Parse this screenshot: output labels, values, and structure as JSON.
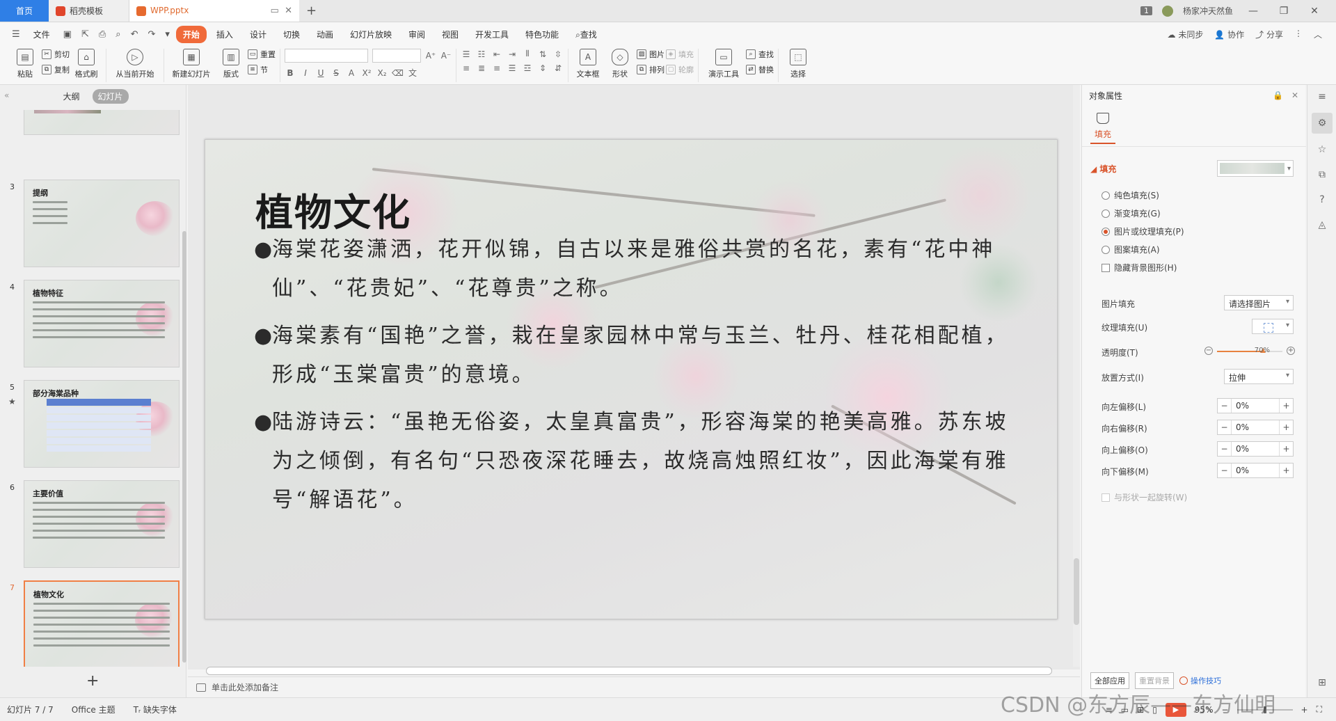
{
  "tabs": [
    {
      "label": "首页"
    },
    {
      "label": "稻壳模板"
    },
    {
      "label": "WPP.pptx"
    }
  ],
  "titlebar": {
    "badge": "1",
    "user": "杨家冲天然鱼"
  },
  "menu": {
    "file": "文件",
    "items": [
      "开始",
      "插入",
      "设计",
      "切换",
      "动画",
      "幻灯片放映",
      "审阅",
      "视图",
      "开发工具",
      "特色功能"
    ],
    "search": "查找",
    "right": [
      "未同步",
      "协作",
      "分享"
    ]
  },
  "ribbon": {
    "paste": "粘贴",
    "cut": "剪切",
    "copy": "复制",
    "format_painter": "格式刷",
    "from_current": "从当前开始",
    "new_slide": "新建幻灯片",
    "layout": "版式",
    "reset": "重置",
    "section": "节",
    "textbox": "文本框",
    "shape": "形状",
    "picture": "图片",
    "arrange": "排列",
    "fill": "填充",
    "outline": "轮廓",
    "present_tools": "演示工具",
    "find": "查找",
    "replace": "替换",
    "select": "选择"
  },
  "leftpane": {
    "tab_outline": "大纲",
    "tab_slides": "幻灯片",
    "slides": [
      {
        "num": "3",
        "title": "提纲",
        "kind": "text"
      },
      {
        "num": "4",
        "title": "植物特征",
        "kind": "text"
      },
      {
        "num": "5",
        "title": "部分海棠品种",
        "kind": "table"
      },
      {
        "num": "6",
        "title": "主要价值",
        "kind": "text"
      },
      {
        "num": "7",
        "title": "植物文化",
        "kind": "text"
      }
    ]
  },
  "slide": {
    "title": "植物文化",
    "bullets": [
      "海棠花姿潇洒，花开似锦，自古以来是雅俗共赏的名花，素有“花中神仙”、“花贵妃”、“花尊贵”之称。",
      "海棠素有“国艳”之誉，栽在皇家园林中常与玉兰、牡丹、桂花相配植，形成“玉棠富贵”的意境。",
      "陆游诗云：“虽艳无俗姿，太皇真富贵”，形容海棠的艳美高雅。苏东坡为之倾倒，有名句“只恐夜深花睡去，故烧高烛照红妆”，因此海棠有雅号“解语花”。"
    ],
    "bullet_symbol": "●"
  },
  "notes": {
    "placeholder": "单击此处添加备注"
  },
  "rightpanel": {
    "header": "对象属性",
    "fill_tab": "填充",
    "section": "填充",
    "options": [
      "纯色填充(S)",
      "渐变填充(G)",
      "图片或纹理填充(P)",
      "图案填充(A)"
    ],
    "selected_option": 2,
    "hide_bg": "隐藏背景图形(H)",
    "picture_fill_label": "图片填充",
    "picture_fill_value": "请选择图片",
    "texture_fill_label": "纹理填充(U)",
    "transparency_label": "透明度(T)",
    "transparency_value": "70%",
    "transparency": 0.7,
    "placement_label": "放置方式(I)",
    "placement_value": "拉伸",
    "offsets": [
      {
        "label": "向左偏移(L)",
        "value": "0%"
      },
      {
        "label": "向右偏移(R)",
        "value": "0%"
      },
      {
        "label": "向上偏移(O)",
        "value": "0%"
      },
      {
        "label": "向下偏移(M)",
        "value": "0%"
      }
    ],
    "rotate_with_shape": "与形状一起旋转(W)",
    "apply_all": "全部应用",
    "reset_bg": "重置背景",
    "tips": "操作技巧"
  },
  "statusbar": {
    "slide_counter": "幻灯片 7 / 7",
    "theme": "Office 主题",
    "missing_font": "缺失字体",
    "zoom": "95%"
  },
  "watermark": "CSDN @东方辰——东方仙明"
}
